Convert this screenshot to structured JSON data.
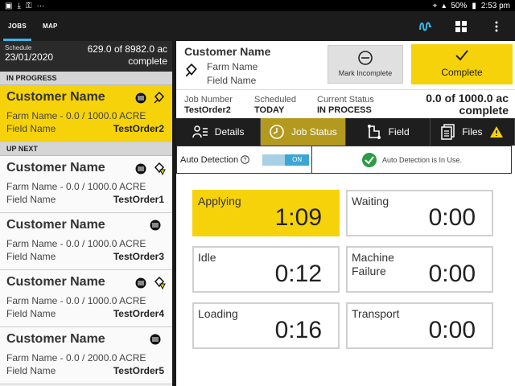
{
  "status_bar": {
    "right_text": "50%",
    "time": "2:53 pm"
  },
  "top_tabs": [
    {
      "label": "JOBS"
    },
    {
      "label": "MAP"
    }
  ],
  "schedule": {
    "label": "Schedule",
    "date": "23/01/2020",
    "acres": "629.0 of 8982.0 ac",
    "status": "complete"
  },
  "sections": {
    "in_progress": "IN PROGRESS",
    "up_next": "UP NEXT"
  },
  "jobs": [
    {
      "customer": "Customer Name",
      "farm": "Farm Name - 0.0 / 1000.0 ACRE",
      "field": "Field Name",
      "order": "TestOrder2"
    },
    {
      "customer": "Customer Name",
      "farm": "Farm Name - 0.0 / 1000.0 ACRE",
      "field": "Field Name",
      "order": "TestOrder1"
    },
    {
      "customer": "Customer Name",
      "farm": "Farm Name - 0.0 / 1000.0 ACRE",
      "field": "Field Name",
      "order": "TestOrder3"
    },
    {
      "customer": "Customer Name",
      "farm": "Farm Name - 0.0 / 1000.0 ACRE",
      "field": "Field Name",
      "order": "TestOrder4"
    },
    {
      "customer": "Customer Name",
      "farm": "Farm Name - 0.0 / 2000.0 ACRE",
      "field": "Field Name",
      "order": "TestOrder5"
    }
  ],
  "detail": {
    "customer": "Customer Name",
    "farm": "Farm Name",
    "field": "Field Name",
    "mark_incomplete": "Mark Incomplete",
    "complete": "Complete",
    "job_number_label": "Job Number",
    "job_number": "TestOrder2",
    "scheduled_label": "Scheduled",
    "scheduled": "TODAY",
    "status_label": "Current Status",
    "status": "IN PROCESS",
    "total_line1": "0.0 of 1000.0 ac",
    "total_line2": "complete"
  },
  "sub_tabs": [
    {
      "label": "Details"
    },
    {
      "label": "Job Status"
    },
    {
      "label": "Field"
    },
    {
      "label": "Files"
    }
  ],
  "auto_detection": {
    "label": "Auto Detection",
    "toggle": "ON",
    "message": "Auto Detection is In Use."
  },
  "status_cards": [
    {
      "label": "Applying",
      "value": "1:09"
    },
    {
      "label": "Waiting",
      "value": "0:00"
    },
    {
      "label": "Idle",
      "value": "0:12"
    },
    {
      "label": "Machine\nFailure",
      "value": "0:00"
    },
    {
      "label": "Loading",
      "value": "0:16"
    },
    {
      "label": "Transport",
      "value": "0:00"
    }
  ],
  "colors": {
    "accent": "#f6d20a",
    "tab_indicator": "#3cb4e6",
    "toggle": "#3ca5d4",
    "check": "#2e9a48"
  }
}
